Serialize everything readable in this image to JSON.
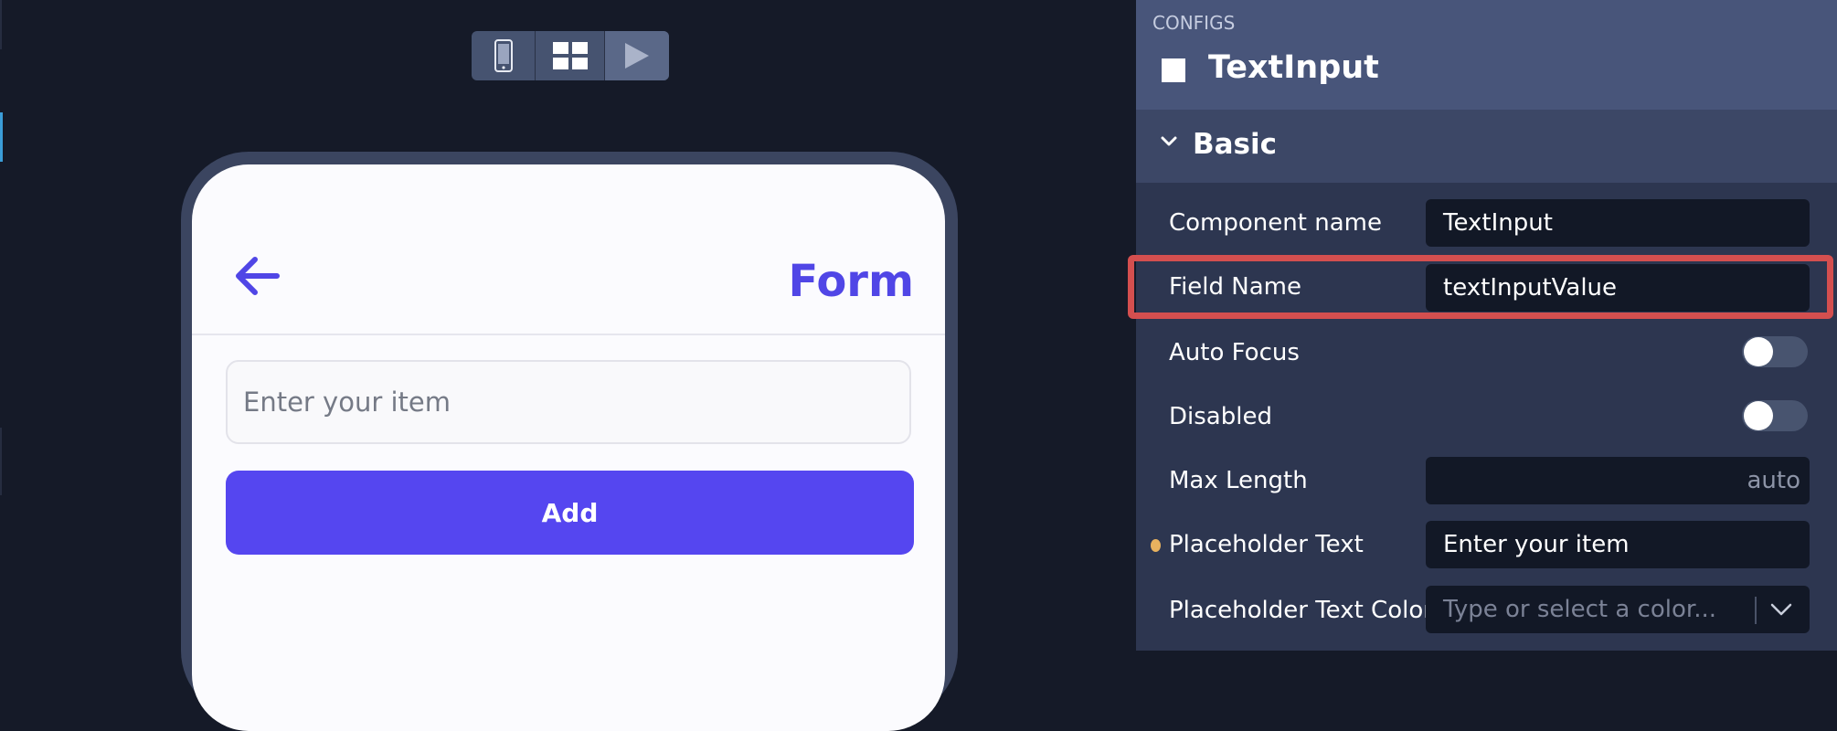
{
  "device_toolbar": {
    "buttons": [
      {
        "icon": "mobile-device-icon"
      },
      {
        "icon": "grid-layout-icon"
      },
      {
        "icon": "play-icon"
      }
    ]
  },
  "preview": {
    "header": {
      "title": "Form",
      "back_icon": "arrow-left-icon"
    },
    "input": {
      "placeholder": "Enter your item",
      "value": ""
    },
    "add_button": {
      "label": "Add"
    },
    "accent_color": "#5546f0"
  },
  "config": {
    "caption": "CONFIGS",
    "component_title": "TextInput",
    "section": {
      "title": "Basic",
      "expanded": true
    },
    "properties": {
      "component_name": {
        "label": "Component name",
        "value": "TextInput"
      },
      "field_name": {
        "label": "Field Name",
        "value": "textInputValue",
        "highlighted": true
      },
      "auto_focus": {
        "label": "Auto Focus",
        "enabled": false
      },
      "disabled": {
        "label": "Disabled",
        "enabled": false
      },
      "max_length": {
        "label": "Max Length",
        "value": "auto"
      },
      "placeholder_text": {
        "label": "Placeholder Text",
        "value": "Enter your item",
        "modified": true
      },
      "placeholder_text_color": {
        "label": "Placeholder Text Color",
        "placeholder": "Type or select a color..."
      }
    }
  },
  "colors": {
    "highlight": "#d44f4f",
    "modified_dot": "#e8b25f",
    "panel_background": "#2d3650"
  }
}
